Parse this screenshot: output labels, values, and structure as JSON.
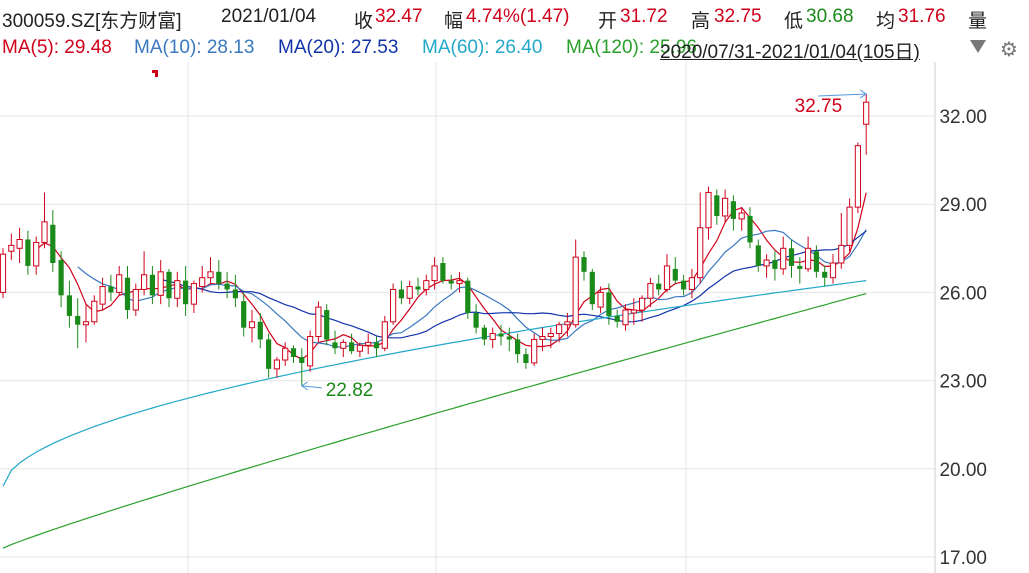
{
  "header": {
    "symbol": "300059.SZ[东方财富]",
    "date": "2021/01/04",
    "close_label": "收",
    "close_value": "32.47",
    "change_label": "幅",
    "change_value": "4.74%(1.47)",
    "open_label": "开",
    "open_value": "31.72",
    "high_label": "高",
    "high_value": "32.75",
    "low_label": "低",
    "low_value": "30.68",
    "avg_label": "均",
    "avg_value": "31.76",
    "volume_label": "量"
  },
  "ma_bar": {
    "items": [
      {
        "label": "MA(5): 29.48",
        "color": "#d0021b"
      },
      {
        "label": "MA(10): 28.13",
        "color": "#3a78c0"
      },
      {
        "label": "MA(20): 27.53",
        "color": "#1133aa"
      },
      {
        "label": "MA(60): 26.40",
        "color": "#22a8c8"
      },
      {
        "label": "MA(120): 25.96",
        "color": "#2aa02a"
      }
    ],
    "range_text": "2020/07/31-2021/01/04(105日)",
    "dropdown_icon": "triangle-down-icon",
    "settings_icon": "gear-icon"
  },
  "chart_data": {
    "type": "candlestick",
    "y_ticks": [
      "32.00",
      "29.00",
      "26.00",
      "23.00",
      "20.00",
      "17.00"
    ],
    "ylim": [
      17.0,
      33.8
    ],
    "grid": true,
    "annotations": [
      {
        "text": "32.75",
        "kind": "period-high"
      },
      {
        "text": "22.82",
        "kind": "period-low"
      }
    ],
    "colors": {
      "up": "#d0021b",
      "down": "#1a8a1a",
      "grid": "#e6e6e6",
      "axis_text": "#333333"
    },
    "candles": [
      [
        26.0,
        27.5,
        25.8,
        27.3
      ],
      [
        27.4,
        28.0,
        27.1,
        27.6
      ],
      [
        27.5,
        28.2,
        27.0,
        27.8
      ],
      [
        27.8,
        28.1,
        26.6,
        26.9
      ],
      [
        26.9,
        27.9,
        26.6,
        27.7
      ],
      [
        27.7,
        29.4,
        27.5,
        28.4
      ],
      [
        28.3,
        28.8,
        26.7,
        27.0
      ],
      [
        27.1,
        27.4,
        25.5,
        25.9
      ],
      [
        25.9,
        26.4,
        24.8,
        25.2
      ],
      [
        25.2,
        25.8,
        24.1,
        24.9
      ],
      [
        24.9,
        25.6,
        24.3,
        25.0
      ],
      [
        25.0,
        25.9,
        24.9,
        25.7
      ],
      [
        25.6,
        26.5,
        25.4,
        26.2
      ],
      [
        26.2,
        26.6,
        25.7,
        26.0
      ],
      [
        26.0,
        26.9,
        25.9,
        26.6
      ],
      [
        26.5,
        26.9,
        25.1,
        25.4
      ],
      [
        25.4,
        26.3,
        25.2,
        26.1
      ],
      [
        26.1,
        27.4,
        25.9,
        26.6
      ],
      [
        26.6,
        26.9,
        25.6,
        25.9
      ],
      [
        25.9,
        27.1,
        25.6,
        26.7
      ],
      [
        26.7,
        26.8,
        25.5,
        25.8
      ],
      [
        25.8,
        26.7,
        25.5,
        26.4
      ],
      [
        26.4,
        26.9,
        25.2,
        25.6
      ],
      [
        25.6,
        26.4,
        25.3,
        26.3
      ],
      [
        26.2,
        26.9,
        26.0,
        26.5
      ],
      [
        26.5,
        27.2,
        26.3,
        26.7
      ],
      [
        26.7,
        27.1,
        26.1,
        26.3
      ],
      [
        26.3,
        26.7,
        25.8,
        26.1
      ],
      [
        26.1,
        26.6,
        25.5,
        25.8
      ],
      [
        25.7,
        26.0,
        24.5,
        24.8
      ],
      [
        24.8,
        25.4,
        24.3,
        25.0
      ],
      [
        25.0,
        25.3,
        24.1,
        24.4
      ],
      [
        24.4,
        24.6,
        23.1,
        23.4
      ],
      [
        23.4,
        23.8,
        23.1,
        23.7
      ],
      [
        23.7,
        24.3,
        23.5,
        24.1
      ],
      [
        24.1,
        24.2,
        23.6,
        23.8
      ],
      [
        23.8,
        24.1,
        22.82,
        23.6
      ],
      [
        23.5,
        24.7,
        23.3,
        24.5
      ],
      [
        24.5,
        25.7,
        24.3,
        25.5
      ],
      [
        25.4,
        25.6,
        24.2,
        24.4
      ],
      [
        24.3,
        24.7,
        23.9,
        24.1
      ],
      [
        24.1,
        24.4,
        23.8,
        24.3
      ],
      [
        24.3,
        24.6,
        23.9,
        24.0
      ],
      [
        24.0,
        24.3,
        23.8,
        24.2
      ],
      [
        24.2,
        24.6,
        23.9,
        24.3
      ],
      [
        24.3,
        24.5,
        23.8,
        24.1
      ],
      [
        24.1,
        25.2,
        24.0,
        25.0
      ],
      [
        25.0,
        26.3,
        24.9,
        26.1
      ],
      [
        26.1,
        26.4,
        25.6,
        25.8
      ],
      [
        25.8,
        26.4,
        25.6,
        26.2
      ],
      [
        26.2,
        26.5,
        25.9,
        26.1
      ],
      [
        26.1,
        26.6,
        25.9,
        26.4
      ],
      [
        26.4,
        27.2,
        26.1,
        26.9
      ],
      [
        27.0,
        27.2,
        26.3,
        26.4
      ],
      [
        26.4,
        26.6,
        26.1,
        26.3
      ],
      [
        26.3,
        26.7,
        26.0,
        26.4
      ],
      [
        26.4,
        26.5,
        25.1,
        25.3
      ],
      [
        25.3,
        25.6,
        24.6,
        24.8
      ],
      [
        24.8,
        24.9,
        24.2,
        24.4
      ],
      [
        24.4,
        24.8,
        24.1,
        24.6
      ],
      [
        24.6,
        24.9,
        24.2,
        24.5
      ],
      [
        24.5,
        24.8,
        24.0,
        24.4
      ],
      [
        24.4,
        24.6,
        23.6,
        23.9
      ],
      [
        23.9,
        24.1,
        23.4,
        23.6
      ],
      [
        23.6,
        24.6,
        23.5,
        24.4
      ],
      [
        24.4,
        24.8,
        24.0,
        24.5
      ],
      [
        24.5,
        24.8,
        24.1,
        24.6
      ],
      [
        24.6,
        25.0,
        24.3,
        24.9
      ],
      [
        24.9,
        25.3,
        24.5,
        25.0
      ],
      [
        24.9,
        27.8,
        24.8,
        27.2
      ],
      [
        27.2,
        27.4,
        26.4,
        26.7
      ],
      [
        26.7,
        26.8,
        25.4,
        25.6
      ],
      [
        25.5,
        26.2,
        25.3,
        26.0
      ],
      [
        26.0,
        26.3,
        24.9,
        25.2
      ],
      [
        25.2,
        25.4,
        24.8,
        25.0
      ],
      [
        24.9,
        25.6,
        24.7,
        25.4
      ],
      [
        25.3,
        25.8,
        24.9,
        25.4
      ],
      [
        25.4,
        25.9,
        25.0,
        25.8
      ],
      [
        25.8,
        26.5,
        25.5,
        26.3
      ],
      [
        26.3,
        26.6,
        25.9,
        26.1
      ],
      [
        26.1,
        27.3,
        26.0,
        26.9
      ],
      [
        26.8,
        27.2,
        26.3,
        26.4
      ],
      [
        26.4,
        26.6,
        25.9,
        26.1
      ],
      [
        26.1,
        26.8,
        25.8,
        26.5
      ],
      [
        26.5,
        29.4,
        26.3,
        28.2
      ],
      [
        28.2,
        29.6,
        27.8,
        29.4
      ],
      [
        29.3,
        29.5,
        28.3,
        28.6
      ],
      [
        28.6,
        29.5,
        28.4,
        29.2
      ],
      [
        29.1,
        29.3,
        28.1,
        28.5
      ],
      [
        28.5,
        28.9,
        28.1,
        28.7
      ],
      [
        28.6,
        28.9,
        27.5,
        27.7
      ],
      [
        27.6,
        27.8,
        26.7,
        26.9
      ],
      [
        26.9,
        27.3,
        26.5,
        27.1
      ],
      [
        27.1,
        27.4,
        26.4,
        26.8
      ],
      [
        26.8,
        27.9,
        26.6,
        27.5
      ],
      [
        27.5,
        27.8,
        26.5,
        26.9
      ],
      [
        26.9,
        27.2,
        26.3,
        26.8
      ],
      [
        26.8,
        27.9,
        26.7,
        27.5
      ],
      [
        27.4,
        27.6,
        26.5,
        26.7
      ],
      [
        26.7,
        26.9,
        26.2,
        26.5
      ],
      [
        26.5,
        27.3,
        26.3,
        27.0
      ],
      [
        27.0,
        28.7,
        26.8,
        27.6
      ],
      [
        27.6,
        29.2,
        27.4,
        28.9
      ],
      [
        28.9,
        31.1,
        28.7,
        30.99
      ],
      [
        31.72,
        32.75,
        30.68,
        32.47
      ]
    ]
  }
}
